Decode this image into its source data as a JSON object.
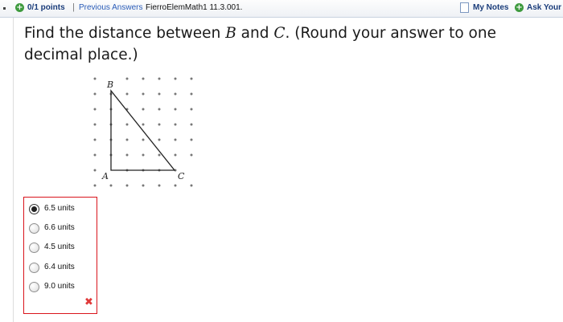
{
  "header": {
    "points": "0/1 points",
    "separator": "|",
    "previous_answers": "Previous Answers",
    "reference": "FierroElemMath1 11.3.001.",
    "my_notes": "My Notes",
    "ask_your": "Ask Your"
  },
  "question": {
    "text_before": "Find the distance between ",
    "point_b": "B",
    "text_and": " and ",
    "point_c": "C",
    "text_after": ". (Round your answer to one decimal place.)"
  },
  "figure": {
    "labels": {
      "a": "A",
      "b": "B",
      "c": "C"
    }
  },
  "choices": [
    {
      "label": "6.5 units",
      "selected": true
    },
    {
      "label": "6.6 units",
      "selected": false
    },
    {
      "label": "4.5 units",
      "selected": false
    },
    {
      "label": "6.4 units",
      "selected": false
    },
    {
      "label": "9.0 units",
      "selected": false
    }
  ],
  "feedback": {
    "icon": "x-mark-icon",
    "symbol": "✖",
    "color": "#e03a3a"
  }
}
